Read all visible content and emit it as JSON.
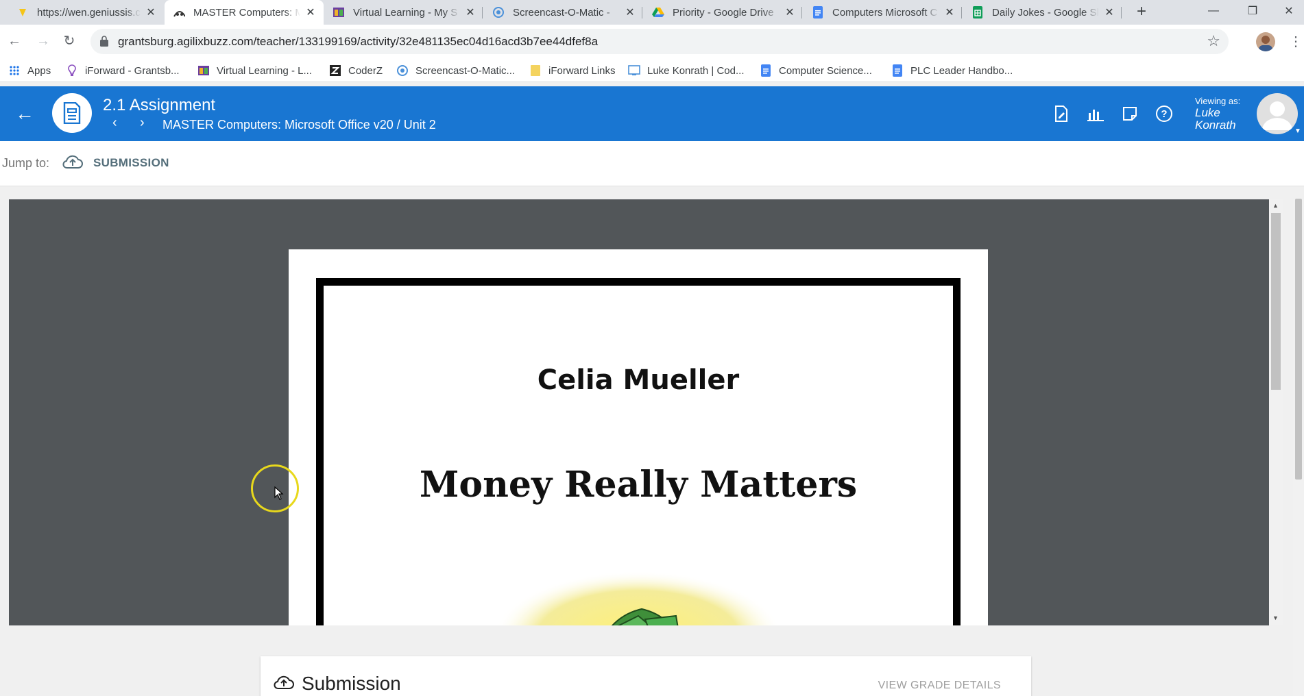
{
  "browser": {
    "tabs": [
      {
        "title": "https://wen.geniussis.c",
        "icon": "genius-favicon",
        "active": false
      },
      {
        "title": "MASTER Computers: M",
        "icon": "buzz-favicon",
        "active": true
      },
      {
        "title": "Virtual Learning - My S",
        "icon": "virtual-learning-favicon",
        "active": false
      },
      {
        "title": "Screencast-O-Matic -",
        "icon": "screencast-favicon",
        "active": false
      },
      {
        "title": "Priority - Google Drive",
        "icon": "google-drive-favicon",
        "active": false
      },
      {
        "title": "Computers Microsoft C",
        "icon": "google-docs-favicon",
        "active": false
      },
      {
        "title": "Daily Jokes - Google Sl",
        "icon": "google-sheets-favicon",
        "active": false
      }
    ],
    "url": "grantsburg.agilixbuzz.com/teacher/133199169/activity/32e481135ec04d16acd3b7ee44dfef8a",
    "bookmarks": [
      {
        "label": "Apps",
        "icon": "apps-grid-icon"
      },
      {
        "label": "iForward - Grantsb...",
        "icon": "iforward-icon"
      },
      {
        "label": "Virtual Learning - L...",
        "icon": "virtual-learning-icon"
      },
      {
        "label": "CoderZ",
        "icon": "coderz-icon"
      },
      {
        "label": "Screencast-O-Matic...",
        "icon": "screencast-icon"
      },
      {
        "label": "iForward Links",
        "icon": "folder-icon"
      },
      {
        "label": "Luke Konrath | Cod...",
        "icon": "code-icon"
      },
      {
        "label": "Computer Science...",
        "icon": "docs-icon"
      },
      {
        "label": "PLC Leader Handbo...",
        "icon": "docs-icon"
      }
    ]
  },
  "header": {
    "title": "2.1 Assignment",
    "breadcrumb": "MASTER Computers: Microsoft Office v20 / Unit 2",
    "viewing_label": "Viewing as:",
    "viewer_name": "Luke Konrath",
    "accent": "#1976d2"
  },
  "jump": {
    "label": "Jump to:",
    "link": "SUBMISSION"
  },
  "document": {
    "author": "Celia Mueller",
    "title": "Money Really Matters"
  },
  "submission": {
    "title": "Submission",
    "grade_link": "VIEW GRADE DETAILS"
  }
}
